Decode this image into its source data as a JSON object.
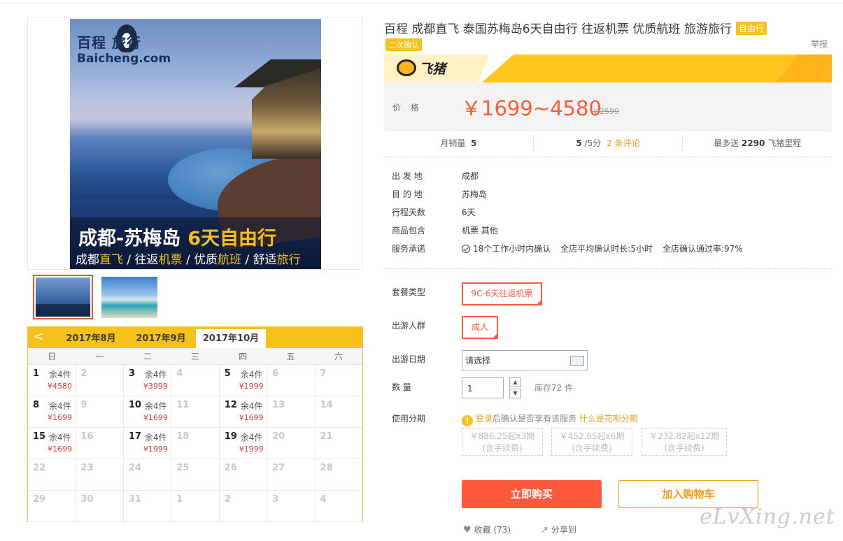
{
  "product": {
    "title": "百程 成都直飞 泰国苏梅岛6天自由行 往返机票 优质航班 旅游旅行",
    "tag_free": "自由行",
    "tag_confirm": "二次确认",
    "report": "举报"
  },
  "poster": {
    "logo_cn": "百程 旅行",
    "logo_en": "Baicheng.com",
    "headline": "成都-苏梅岛",
    "headline_accent": "6天自由行",
    "sub_1": "成都",
    "sub_2": "直飞",
    "sub_3": " / 往返",
    "sub_4": "机票",
    "sub_5": " / 优质",
    "sub_6": "航班",
    "sub_7": " / 舒适",
    "sub_8": "旅行"
  },
  "brand": {
    "name": "飞猪"
  },
  "price": {
    "label": "价格",
    "range": "￥1699~4580",
    "original": "￥2599"
  },
  "stats": {
    "sales_label": "月销量",
    "sales_value": "5",
    "rating_value": "5",
    "rating_suffix": "/5分",
    "reviews": "2 条评论",
    "miles_prefix": "最多送",
    "miles_value": "2290",
    "miles_suffix": "飞猪里程"
  },
  "info": {
    "departure_label": "出 发 地",
    "departure": "成都",
    "destination_label": "目 的 地",
    "destination": "苏梅岛",
    "days_label": "行程天数",
    "days": "6天",
    "includes_label": "商品包含",
    "includes": "机票  其他",
    "service_label": "服务承诺",
    "service_1": "18个工作小时内确认",
    "service_2": "全店平均确认时长:5小时",
    "service_3": "全店确认通过率:97%"
  },
  "options": {
    "package_label": "套餐类型",
    "package_value": "9C-6天往返机票",
    "crowd_label": "出游人群",
    "crowd_value": "成人",
    "date_label": "出游日期",
    "date_value": "请选择",
    "qty_label": "数    量",
    "qty_value": "1",
    "stock": "库存72 件",
    "installment_label": "使用分期",
    "huabei_login": "登录",
    "huabei_text": "后确认是否享有该服务",
    "huabei_link": "什么是花呗分期",
    "inst": [
      {
        "line1": "￥886.25起x3期",
        "line2": "(含手续费)"
      },
      {
        "line1": "￥452.65起x6期",
        "line2": "(含手续费)"
      },
      {
        "line1": "￥232.82起x12期",
        "line2": "(含手续费)"
      }
    ]
  },
  "actions": {
    "buy": "立即购买",
    "cart": "加入购物车",
    "fav": "收藏 (73)",
    "share": "分享到"
  },
  "calendar": {
    "prev": "<",
    "months": [
      "2017年8月",
      "2017年9月",
      "2017年10月"
    ],
    "active_month": "2017年10月",
    "weekdays": [
      "日",
      "一",
      "二",
      "三",
      "四",
      "五",
      "六"
    ],
    "weeks": [
      [
        {
          "d": "1",
          "s": "余4件",
          "p": "¥4580"
        },
        {
          "d": "2"
        },
        {
          "d": "3",
          "s": "余4件",
          "p": "¥3999"
        },
        {
          "d": "4"
        },
        {
          "d": "5",
          "s": "余4件",
          "p": "¥1999"
        },
        {
          "d": "6"
        },
        {
          "d": "7"
        }
      ],
      [
        {
          "d": "8",
          "s": "余4件",
          "p": "¥1699"
        },
        {
          "d": "9"
        },
        {
          "d": "10",
          "s": "余4件",
          "p": "¥1699"
        },
        {
          "d": "11"
        },
        {
          "d": "12",
          "s": "余4件",
          "p": "¥1699"
        },
        {
          "d": "13"
        },
        {
          "d": "14"
        }
      ],
      [
        {
          "d": "15",
          "s": "余4件",
          "p": "¥1699"
        },
        {
          "d": "16"
        },
        {
          "d": "17",
          "s": "余4件",
          "p": "¥1999"
        },
        {
          "d": "18"
        },
        {
          "d": "19",
          "s": "余4件",
          "p": "¥1999"
        },
        {
          "d": "20"
        },
        {
          "d": "21"
        }
      ],
      [
        {
          "d": "22"
        },
        {
          "d": "23"
        },
        {
          "d": "24"
        },
        {
          "d": "25"
        },
        {
          "d": "26"
        },
        {
          "d": "27"
        },
        {
          "d": "28"
        }
      ],
      [
        {
          "d": "29"
        },
        {
          "d": "30"
        },
        {
          "d": "31"
        },
        {
          "d": "1"
        },
        {
          "d": "2"
        },
        {
          "d": "3"
        },
        {
          "d": "4"
        }
      ]
    ]
  },
  "watermark": "eLvXing.net",
  "colors": {
    "accent": "#ff5a3c",
    "brand_yellow": "#f6c21a"
  }
}
